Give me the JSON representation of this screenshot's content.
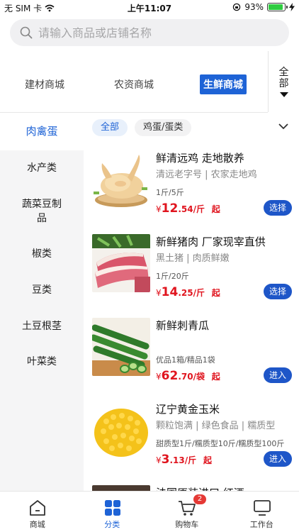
{
  "status_bar": {
    "carrier": "无 SIM 卡",
    "time": "上午11:07",
    "battery": "93%",
    "battery_level": 0.93
  },
  "search": {
    "placeholder": "请输入商品或店铺名称"
  },
  "top_tabs": [
    {
      "label": "建材商城",
      "active": false
    },
    {
      "label": "农资商城",
      "active": false
    },
    {
      "label": "生鲜商城",
      "active": true
    }
  ],
  "all_toggle": {
    "line1": "全",
    "line2": "部"
  },
  "chips": [
    {
      "label": "全部",
      "active": true
    },
    {
      "label": "鸡蛋/蛋类",
      "active": false
    }
  ],
  "categories": [
    {
      "label": "肉禽蛋",
      "active": true
    },
    {
      "label": "水产类"
    },
    {
      "label": "蔬菜豆制品"
    },
    {
      "label": "椒类"
    },
    {
      "label": "豆类"
    },
    {
      "label": "土豆根茎"
    },
    {
      "label": "叶菜类"
    }
  ],
  "products": [
    {
      "name": "鲜清远鸡 走地散养",
      "desc": "清远老字号 | 农家走地鸡",
      "spec": "1斤/5斤",
      "currency": "¥",
      "price_int": "12",
      "price_dec": ".54/斤",
      "suffix": "起",
      "button": "选择",
      "image": "chicken"
    },
    {
      "name": "新鲜猪肉 厂家现宰直供",
      "desc": "黑土猪 | 肉质鲜嫩",
      "spec": "1斤/20斤",
      "currency": "¥",
      "price_int": "14",
      "price_dec": ".25/斤",
      "suffix": "起",
      "button": "选择",
      "image": "pork"
    },
    {
      "name": "新鲜刺青瓜",
      "desc": "",
      "spec": "优品1箱/精品1袋",
      "currency": "¥",
      "price_int": "62",
      "price_dec": ".70/袋",
      "suffix": "起",
      "button": "进入",
      "image": "cucumber"
    },
    {
      "name": "辽宁黄金玉米",
      "desc": "颗粒饱满 | 绿色食品 | 糯质型",
      "spec": "甜质型1斤/糯质型10斤/糯质型100斤",
      "currency": "¥",
      "price_int": "3",
      "price_dec": ".13/斤",
      "suffix": "起",
      "button": "进入",
      "image": "corn"
    },
    {
      "name": "法国原装进口 红酒",
      "image": "wine"
    }
  ],
  "tab_bar": [
    {
      "label": "商城",
      "icon": "home-icon",
      "active": false
    },
    {
      "label": "分类",
      "icon": "grid-icon",
      "active": true
    },
    {
      "label": "购物车",
      "icon": "cart-icon",
      "active": false,
      "badge": "2"
    },
    {
      "label": "工作台",
      "icon": "monitor-icon",
      "active": false
    }
  ],
  "colors": {
    "accent": "#1e63d6",
    "price": "#e0141e",
    "button": "#1e56c8"
  }
}
